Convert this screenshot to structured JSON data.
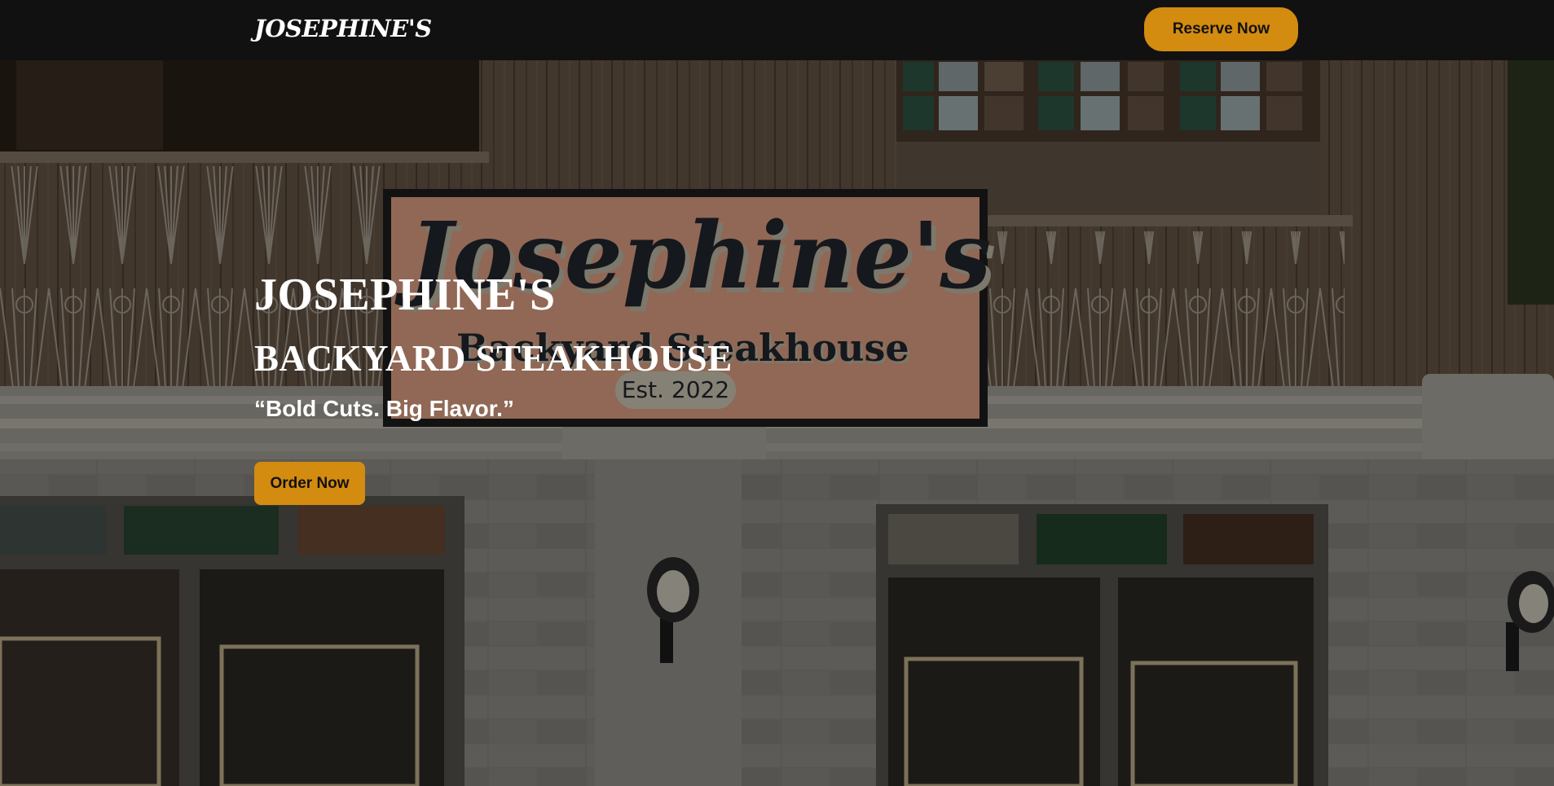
{
  "navbar": {
    "brand": "JOSEPHINE'S",
    "reserve_label": "Reserve Now"
  },
  "hero": {
    "title": "JOSEPHINE'S",
    "subtitle": "BACKYARD STEAKHOUSE",
    "tagline": "“Bold Cuts. Big Flavor.”",
    "order_label": "Order Now",
    "photo": {
      "sign_script": "Josephine's",
      "sign_subtitle": "Backyard Steakhouse",
      "sign_est": "Est. 2022"
    }
  },
  "colors": {
    "navbar_bg": "#111111",
    "accent": "#d38b10",
    "text_light": "#ffffff",
    "button_text": "#111111"
  }
}
